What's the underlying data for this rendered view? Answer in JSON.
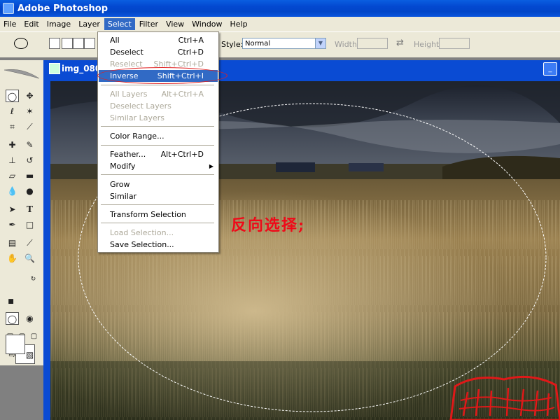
{
  "app": {
    "title": "Adobe Photoshop"
  },
  "menubar": [
    "File",
    "Edit",
    "Image",
    "Layer",
    "Select",
    "Filter",
    "View",
    "Window",
    "Help"
  ],
  "active_menu": "Select",
  "options": {
    "style_label": "Style:",
    "style_value": "Normal",
    "width_label": "Width:",
    "height_label": "Height:"
  },
  "document": {
    "title": "img_080"
  },
  "select_menu": {
    "items": [
      {
        "label": "All",
        "shortcut": "Ctrl+A",
        "enabled": true
      },
      {
        "label": "Deselect",
        "shortcut": "Ctrl+D",
        "enabled": true
      },
      {
        "label": "Reselect",
        "shortcut": "Shift+Ctrl+D",
        "enabled": false
      },
      {
        "label": "Inverse",
        "shortcut": "Shift+Ctrl+I",
        "enabled": true,
        "highlighted": true
      },
      {
        "label": "All Layers",
        "shortcut": "Alt+Ctrl+A",
        "enabled": false
      },
      {
        "label": "Deselect Layers",
        "shortcut": "",
        "enabled": false
      },
      {
        "label": "Similar Layers",
        "shortcut": "",
        "enabled": false
      },
      {
        "label": "Color Range...",
        "shortcut": "",
        "enabled": true
      },
      {
        "label": "Feather...",
        "shortcut": "Alt+Ctrl+D",
        "enabled": true
      },
      {
        "label": "Modify",
        "shortcut": "",
        "enabled": true,
        "submenu": true
      },
      {
        "label": "Grow",
        "shortcut": "",
        "enabled": true
      },
      {
        "label": "Similar",
        "shortcut": "",
        "enabled": true
      },
      {
        "label": "Transform Selection",
        "shortcut": "",
        "enabled": true
      },
      {
        "label": "Load Selection...",
        "shortcut": "",
        "enabled": false
      },
      {
        "label": "Save Selection...",
        "shortcut": "",
        "enabled": true
      }
    ]
  },
  "annotation": {
    "text": "反向选择;"
  },
  "colors": {
    "menu_highlight": "#316ac5",
    "annotation_red": "#f00818"
  }
}
